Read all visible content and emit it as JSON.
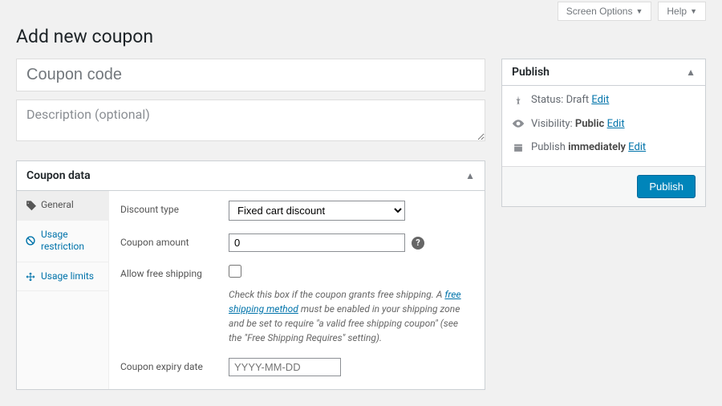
{
  "topbar": {
    "screen_options": "Screen Options",
    "help": "Help"
  },
  "page_title": "Add new coupon",
  "title_placeholder": "Coupon code",
  "desc_placeholder": "Description (optional)",
  "coupon_data": {
    "header": "Coupon data",
    "tabs": {
      "general": "General",
      "usage_restriction": "Usage restriction",
      "usage_limits": "Usage limits"
    },
    "fields": {
      "discount_type_label": "Discount type",
      "discount_type_value": "Fixed cart discount",
      "coupon_amount_label": "Coupon amount",
      "coupon_amount_value": "0",
      "free_shipping_label": "Allow free shipping",
      "free_shipping_desc_1": "Check this box if the coupon grants free shipping. A ",
      "free_shipping_link": "free shipping method",
      "free_shipping_desc_2": " must be enabled in your shipping zone and be set to require \"a valid free shipping coupon\" (see the \"Free Shipping Requires\" setting).",
      "expiry_label": "Coupon expiry date",
      "expiry_placeholder": "YYYY-MM-DD"
    }
  },
  "publish": {
    "header": "Publish",
    "status_label": "Status:",
    "status_value": "Draft",
    "visibility_label": "Visibility:",
    "visibility_value": "Public",
    "schedule_label": "Publish",
    "schedule_value": "immediately",
    "edit": "Edit",
    "button": "Publish"
  }
}
